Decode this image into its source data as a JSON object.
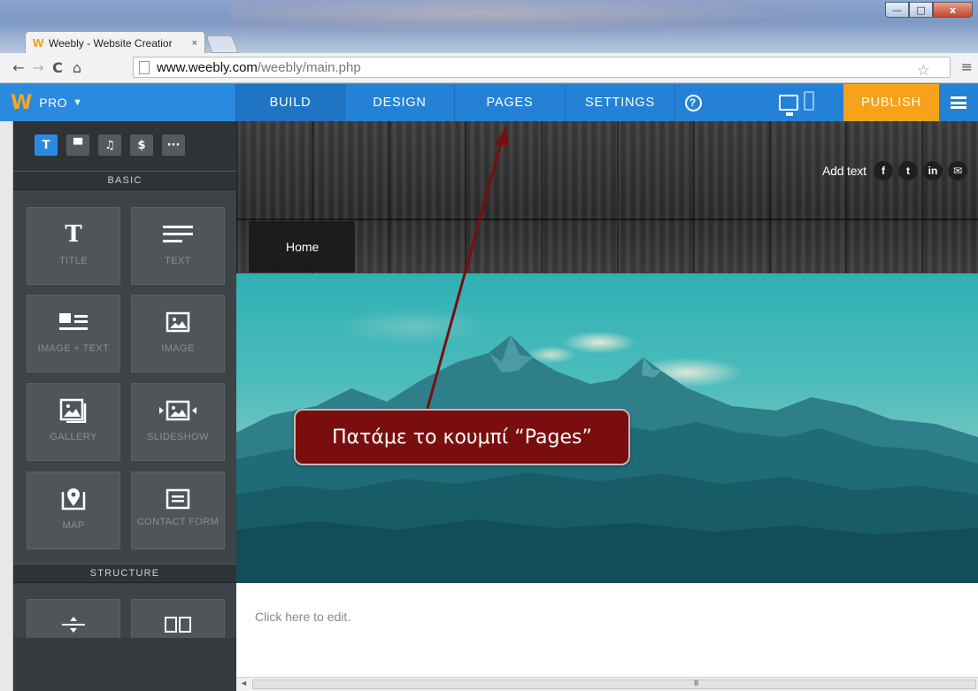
{
  "browser": {
    "tab_title": "Weebly - Website Creatior",
    "tab_close": "×",
    "url_host": "www.weebly.com",
    "url_path": "/weebly/main.php",
    "window_buttons": {
      "minimize": "—",
      "maximize": "□",
      "close": "x"
    }
  },
  "appbar": {
    "plan_label": "PRO",
    "nav": {
      "build": "BUILD",
      "design": "DESIGN",
      "pages": "PAGES",
      "settings": "SETTINGS"
    },
    "help_label": "?",
    "publish_label": "PUBLISH",
    "colors": {
      "bar": "#2481d6",
      "publish": "#f7a21b",
      "logo": "#f6a623"
    }
  },
  "sidebar": {
    "categories": [
      {
        "icon": "text-icon",
        "glyph": "T"
      },
      {
        "icon": "structure-icon",
        "glyph": "▀"
      },
      {
        "icon": "music-icon",
        "glyph": "♫"
      },
      {
        "icon": "dollar-icon",
        "glyph": "$"
      },
      {
        "icon": "more-icon",
        "glyph": "···"
      }
    ],
    "basic_header": "BASIC",
    "structure_header": "STRUCTURE",
    "tiles": {
      "title": "TITLE",
      "text": "TEXT",
      "image_text": "IMAGE + TEXT",
      "image": "IMAGE",
      "gallery": "GALLERY",
      "slideshow": "SLIDESHOW",
      "map": "MAP",
      "contact_form": "CONTACT FORM"
    }
  },
  "site": {
    "add_text": "Add text",
    "social": [
      "f",
      "t",
      "in",
      "✉"
    ],
    "nav_home": "Home",
    "body_placeholder": "Click here to edit."
  },
  "annotation": {
    "callout_text": "Πατάμε το κουμπί “Pages”",
    "color": "#7a0d0d"
  }
}
